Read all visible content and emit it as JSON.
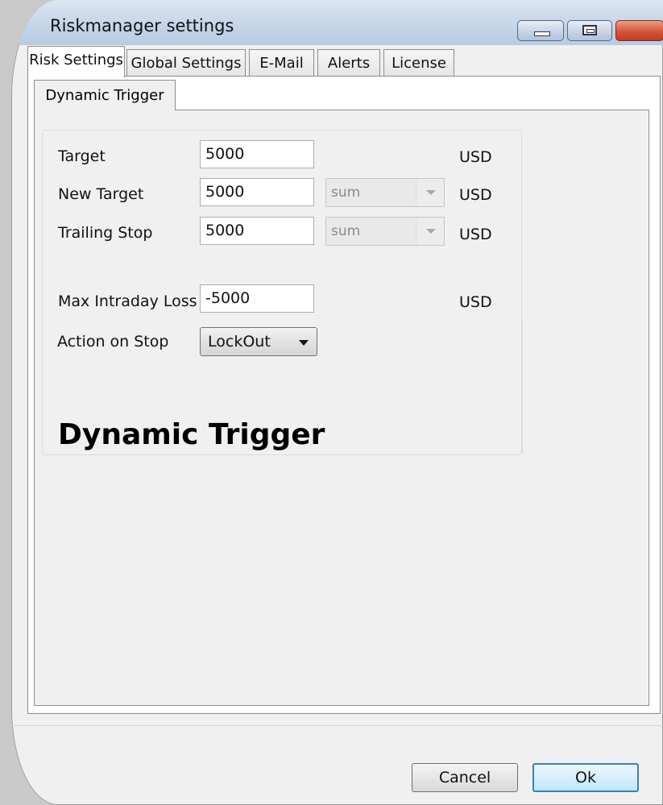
{
  "window": {
    "title": "Riskmanager settings"
  },
  "tabs": [
    {
      "label": "Risk Settings",
      "active": true
    },
    {
      "label": "Global Settings",
      "active": false
    },
    {
      "label": "E-Mail",
      "active": false
    },
    {
      "label": "Alerts",
      "active": false
    },
    {
      "label": "License",
      "active": false
    }
  ],
  "inner_tab": {
    "label": "Dynamic Trigger"
  },
  "form": {
    "target": {
      "label": "Target",
      "value": "5000",
      "unit": "USD"
    },
    "new_target": {
      "label": "New Target",
      "value": "5000",
      "mode": "sum",
      "unit": "USD"
    },
    "trailing_stop": {
      "label": "Trailing Stop",
      "value": "5000",
      "mode": "sum",
      "unit": "USD"
    },
    "max_intraday_loss": {
      "label": "Max Intraday Loss",
      "value": "-5000",
      "unit": "USD"
    },
    "action_on_stop": {
      "label": "Action on Stop",
      "value": "LockOut"
    }
  },
  "section_heading": "Dynamic Trigger",
  "buttons": {
    "cancel": "Cancel",
    "ok": "Ok"
  },
  "colors": {
    "titlebar": "#c9d8ea",
    "window_bg": "#f0f0f0",
    "ok_border": "#3c7fb1"
  }
}
